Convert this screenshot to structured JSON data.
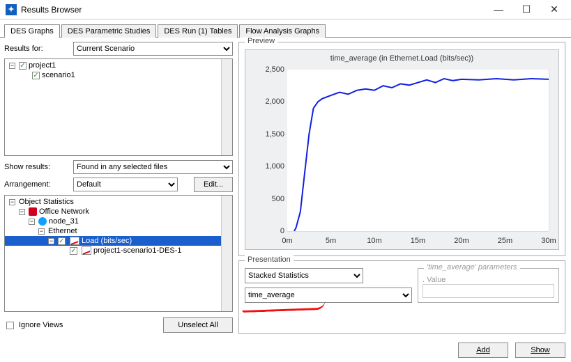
{
  "window": {
    "title": "Results Browser",
    "min": "—",
    "max": "☐",
    "close": "✕"
  },
  "tabs": [
    "DES Graphs",
    "DES Parametric Studies",
    "DES Run (1) Tables",
    "Flow Analysis Graphs"
  ],
  "left": {
    "resultsFor": {
      "label": "Results for:",
      "value": "Current Scenario"
    },
    "tree1": {
      "root": "project1",
      "child": "scenario1"
    },
    "showResults": {
      "label": "Show results:",
      "value": "Found in any selected files"
    },
    "arrangement": {
      "label": "Arrangement:",
      "value": "Default",
      "editBtn": "Edit..."
    },
    "tree2": {
      "root": "Object Statistics",
      "office": "Office Network",
      "node": "node_31",
      "eth": "Ethernet",
      "load": "Load (bits/sec)",
      "run": "project1-scenario1-DES-1"
    },
    "ignore": {
      "label": "Ignore Views"
    },
    "unselectBtn": "Unselect All"
  },
  "preview": {
    "legend": "Preview",
    "title": "time_average (in Ethernet.Load (bits/sec))"
  },
  "presentation": {
    "legend": "Presentation",
    "mode": "Stacked Statistics",
    "func": "time_average",
    "paramsLegend": "'time_average' parameters",
    "paramLabel": ". Value"
  },
  "footer": {
    "add": "Add",
    "show": "Show"
  },
  "chart_data": {
    "type": "line",
    "title": "time_average (in Ethernet.Load (bits/sec))",
    "xlabel": "",
    "ylabel": "",
    "ylim": [
      0,
      2500
    ],
    "yticks": [
      0,
      500,
      1000,
      1500,
      2000,
      2500
    ],
    "xticks": [
      "0m",
      "5m",
      "10m",
      "15m",
      "20m",
      "25m",
      "30m"
    ],
    "series": [
      {
        "name": "time_average",
        "color": "#1020e0",
        "x_minutes": [
          0.8,
          1.0,
          1.5,
          2.0,
          2.5,
          3.0,
          3.5,
          4.0,
          5.0,
          6.0,
          7.0,
          8.0,
          9.0,
          10.0,
          11.0,
          12.0,
          13.0,
          14.0,
          15.0,
          16.0,
          17.0,
          18.0,
          19.0,
          20.0,
          22.0,
          24.0,
          26.0,
          28.0,
          30.0
        ],
        "y": [
          0,
          50,
          300,
          900,
          1500,
          1900,
          2000,
          2050,
          2100,
          2150,
          2120,
          2180,
          2200,
          2180,
          2250,
          2220,
          2280,
          2260,
          2300,
          2340,
          2300,
          2360,
          2330,
          2350,
          2340,
          2360,
          2340,
          2360,
          2350
        ]
      }
    ]
  }
}
